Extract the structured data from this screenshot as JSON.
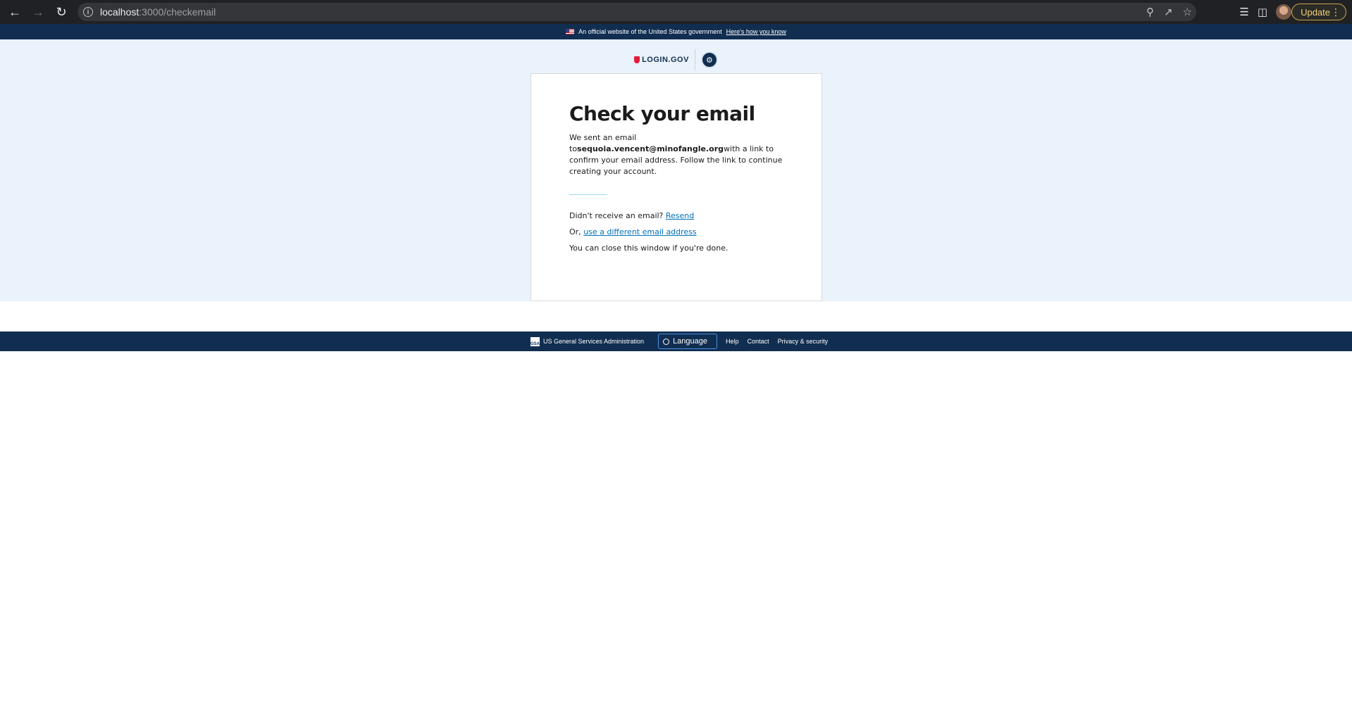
{
  "browser": {
    "url_host": "localhost",
    "url_path": ":3000/checkemail",
    "update_label": "Update"
  },
  "gov_banner": {
    "text": "An official website of the United States government",
    "link": "Here's how you know"
  },
  "header": {
    "logo_text": "LOGIN.GOV"
  },
  "card": {
    "title": "Check your email",
    "intro_prefix": "We sent an email to",
    "email": "sequoia.vencent@minofangle.org",
    "intro_suffix": "with a link to confirm your email address. Follow the link to continue creating your account.",
    "resend_prefix": "Didn't receive an email? ",
    "resend_link": "Resend",
    "change_prefix": "Or, ",
    "change_link": "use a different email address",
    "close_text": "You can close this window if you're done."
  },
  "footer": {
    "gsa_label": "US General Services Administration",
    "gsa_logo_text": "GSA",
    "language_label": "Language",
    "links": [
      "Help",
      "Contact",
      "Privacy & security"
    ]
  },
  "colors": {
    "gov_blue": "#112e51",
    "page_bg": "#eaf2fb",
    "link": "#0071bb",
    "logo_red": "#e21c3d"
  }
}
